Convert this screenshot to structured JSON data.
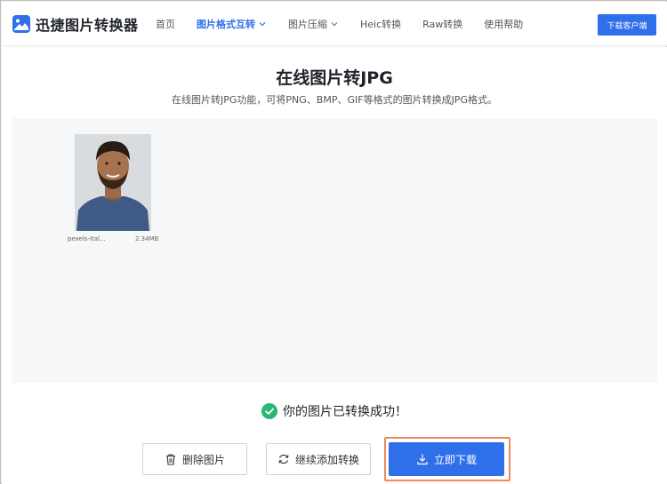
{
  "brand": {
    "name": "迅捷图片转换器",
    "icon": "image-logo-icon",
    "color": "#2f6fe9"
  },
  "nav": {
    "items": [
      {
        "label": "首页",
        "active": false,
        "dropdown": false
      },
      {
        "label": "图片格式互转",
        "active": true,
        "dropdown": true
      },
      {
        "label": "图片压缩",
        "active": false,
        "dropdown": true
      },
      {
        "label": "Heic转换",
        "active": false,
        "dropdown": false
      },
      {
        "label": "Raw转换",
        "active": false,
        "dropdown": false
      },
      {
        "label": "使用帮助",
        "active": false,
        "dropdown": false
      }
    ],
    "client_button": "下载客户端"
  },
  "page": {
    "title": "在线图片转JPG",
    "subtitle": "在线图片转JPG功能，可将PNG、BMP、GIF等格式的图片转换成JPG格式。"
  },
  "file": {
    "name": "pexels-ital...",
    "size": "2.34MB",
    "preview": "portrait-thumbnail"
  },
  "status": {
    "text": "你的图片已转换成功！",
    "icon": "check-circle-icon",
    "color": "#2bb673"
  },
  "actions": {
    "delete_label": "删除图片",
    "continue_label": "继续添加转换",
    "download_label": "立即下载"
  }
}
